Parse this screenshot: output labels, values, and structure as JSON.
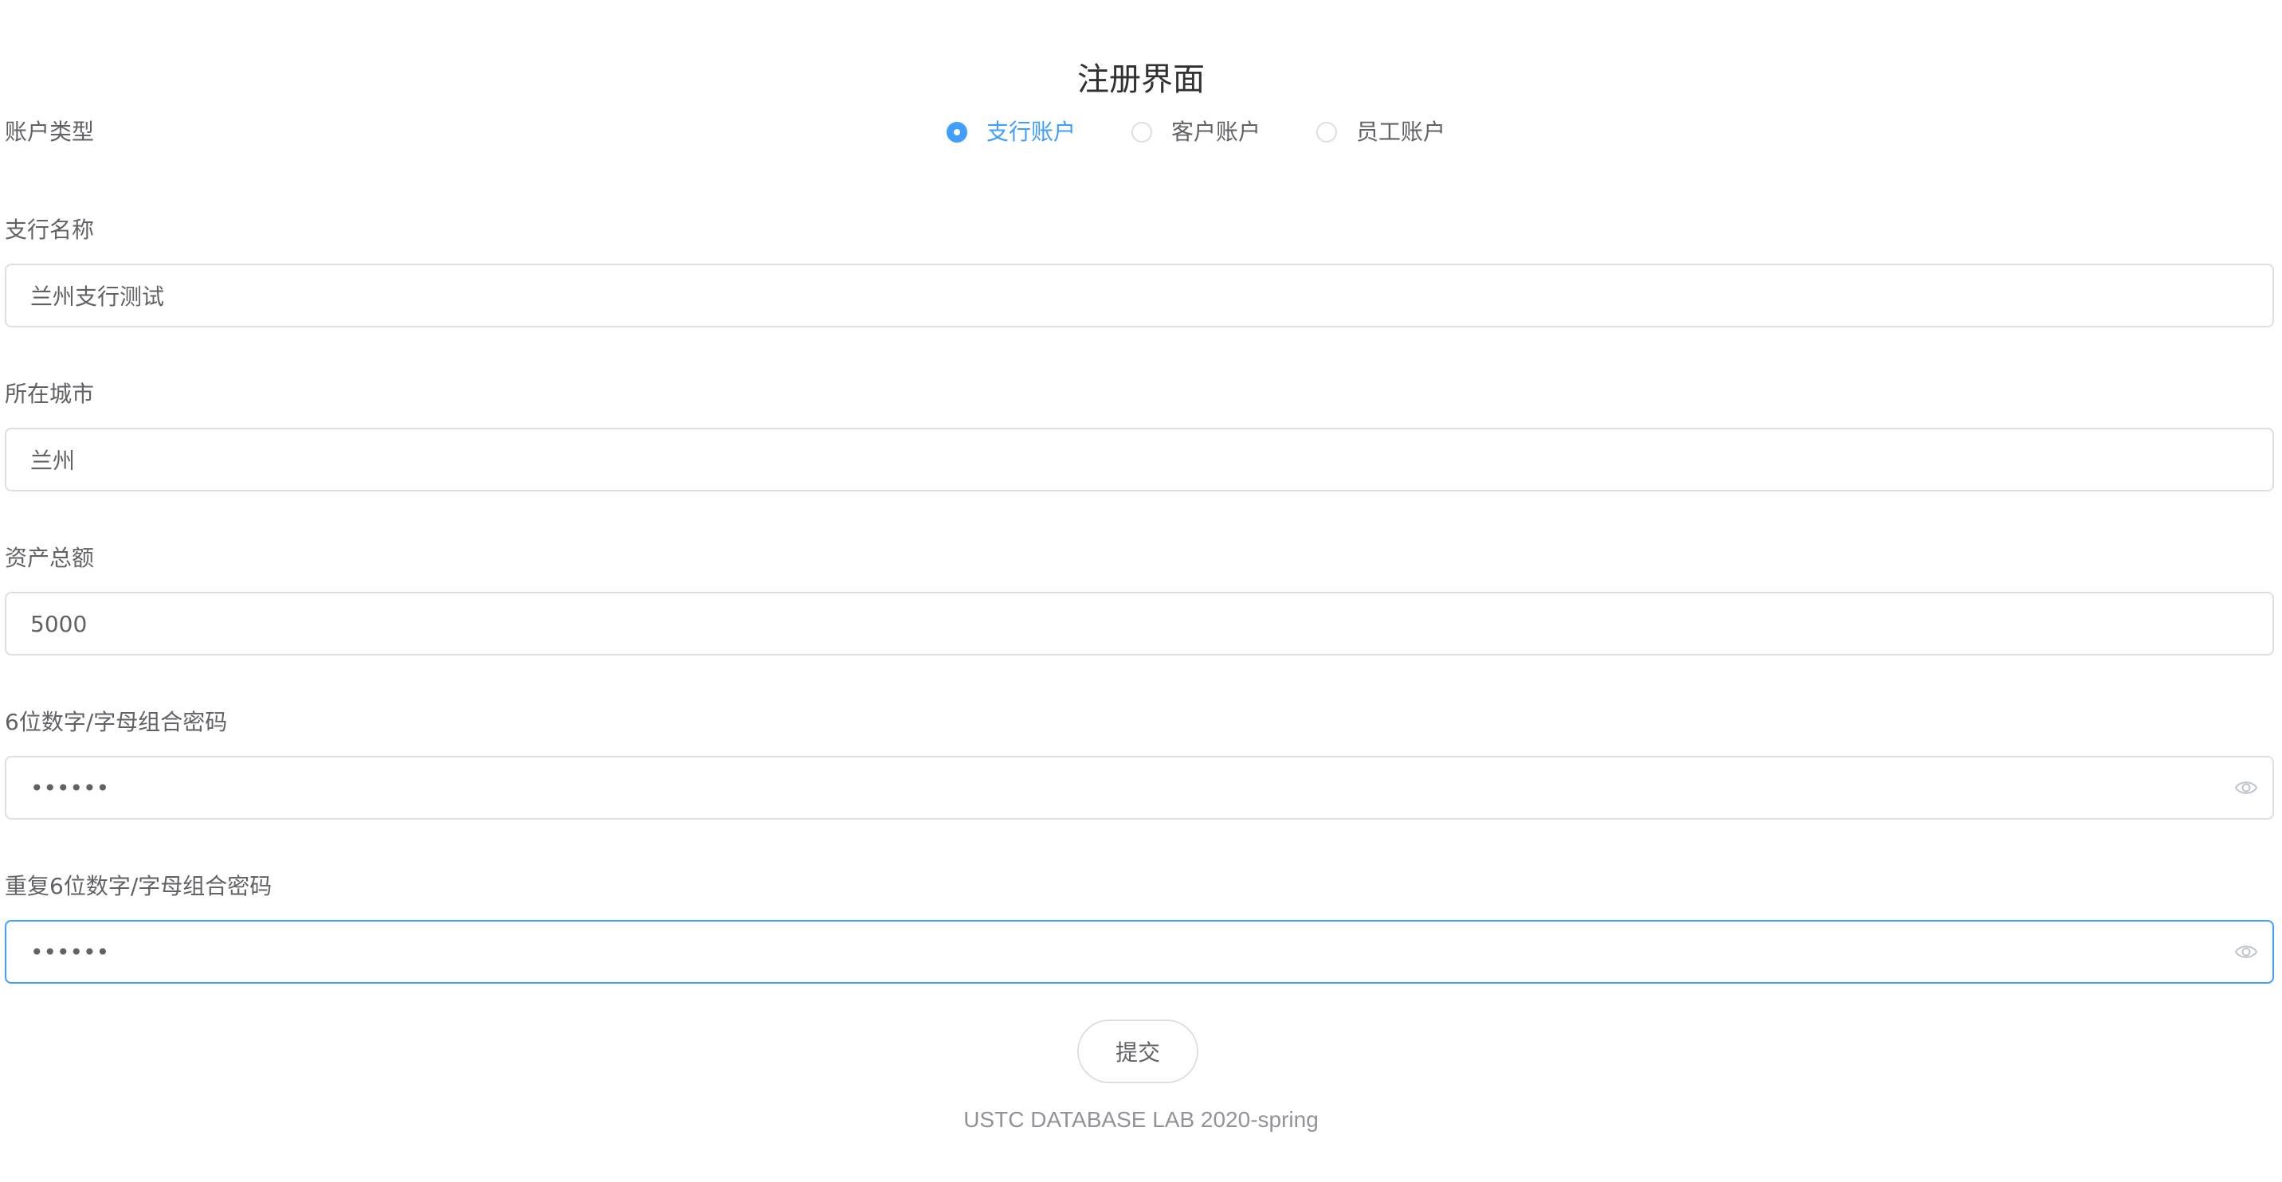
{
  "page": {
    "title": "注册界面",
    "footer": "USTC DATABASE LAB 2020-spring"
  },
  "account_type": {
    "label": "账户类型",
    "options": [
      "支行账户",
      "客户账户",
      "员工账户"
    ],
    "selected": "支行账户"
  },
  "fields": {
    "branch_name": {
      "label": "支行名称",
      "value": "兰州支行测试"
    },
    "city": {
      "label": "所在城市",
      "value": "兰州"
    },
    "assets": {
      "label": "资产总额",
      "value": "5000"
    },
    "password": {
      "label": "6位数字/字母组合密码",
      "value": "••••••"
    },
    "password_confirm": {
      "label": "重复6位数字/字母组合密码",
      "value": "••••••"
    }
  },
  "submit_label": "提交",
  "colors": {
    "accent": "#409eff",
    "border": "#dcdfe6",
    "text": "#606266",
    "title": "#303133",
    "footer": "#909399"
  },
  "icons": {
    "password_toggle": "eye-icon"
  }
}
